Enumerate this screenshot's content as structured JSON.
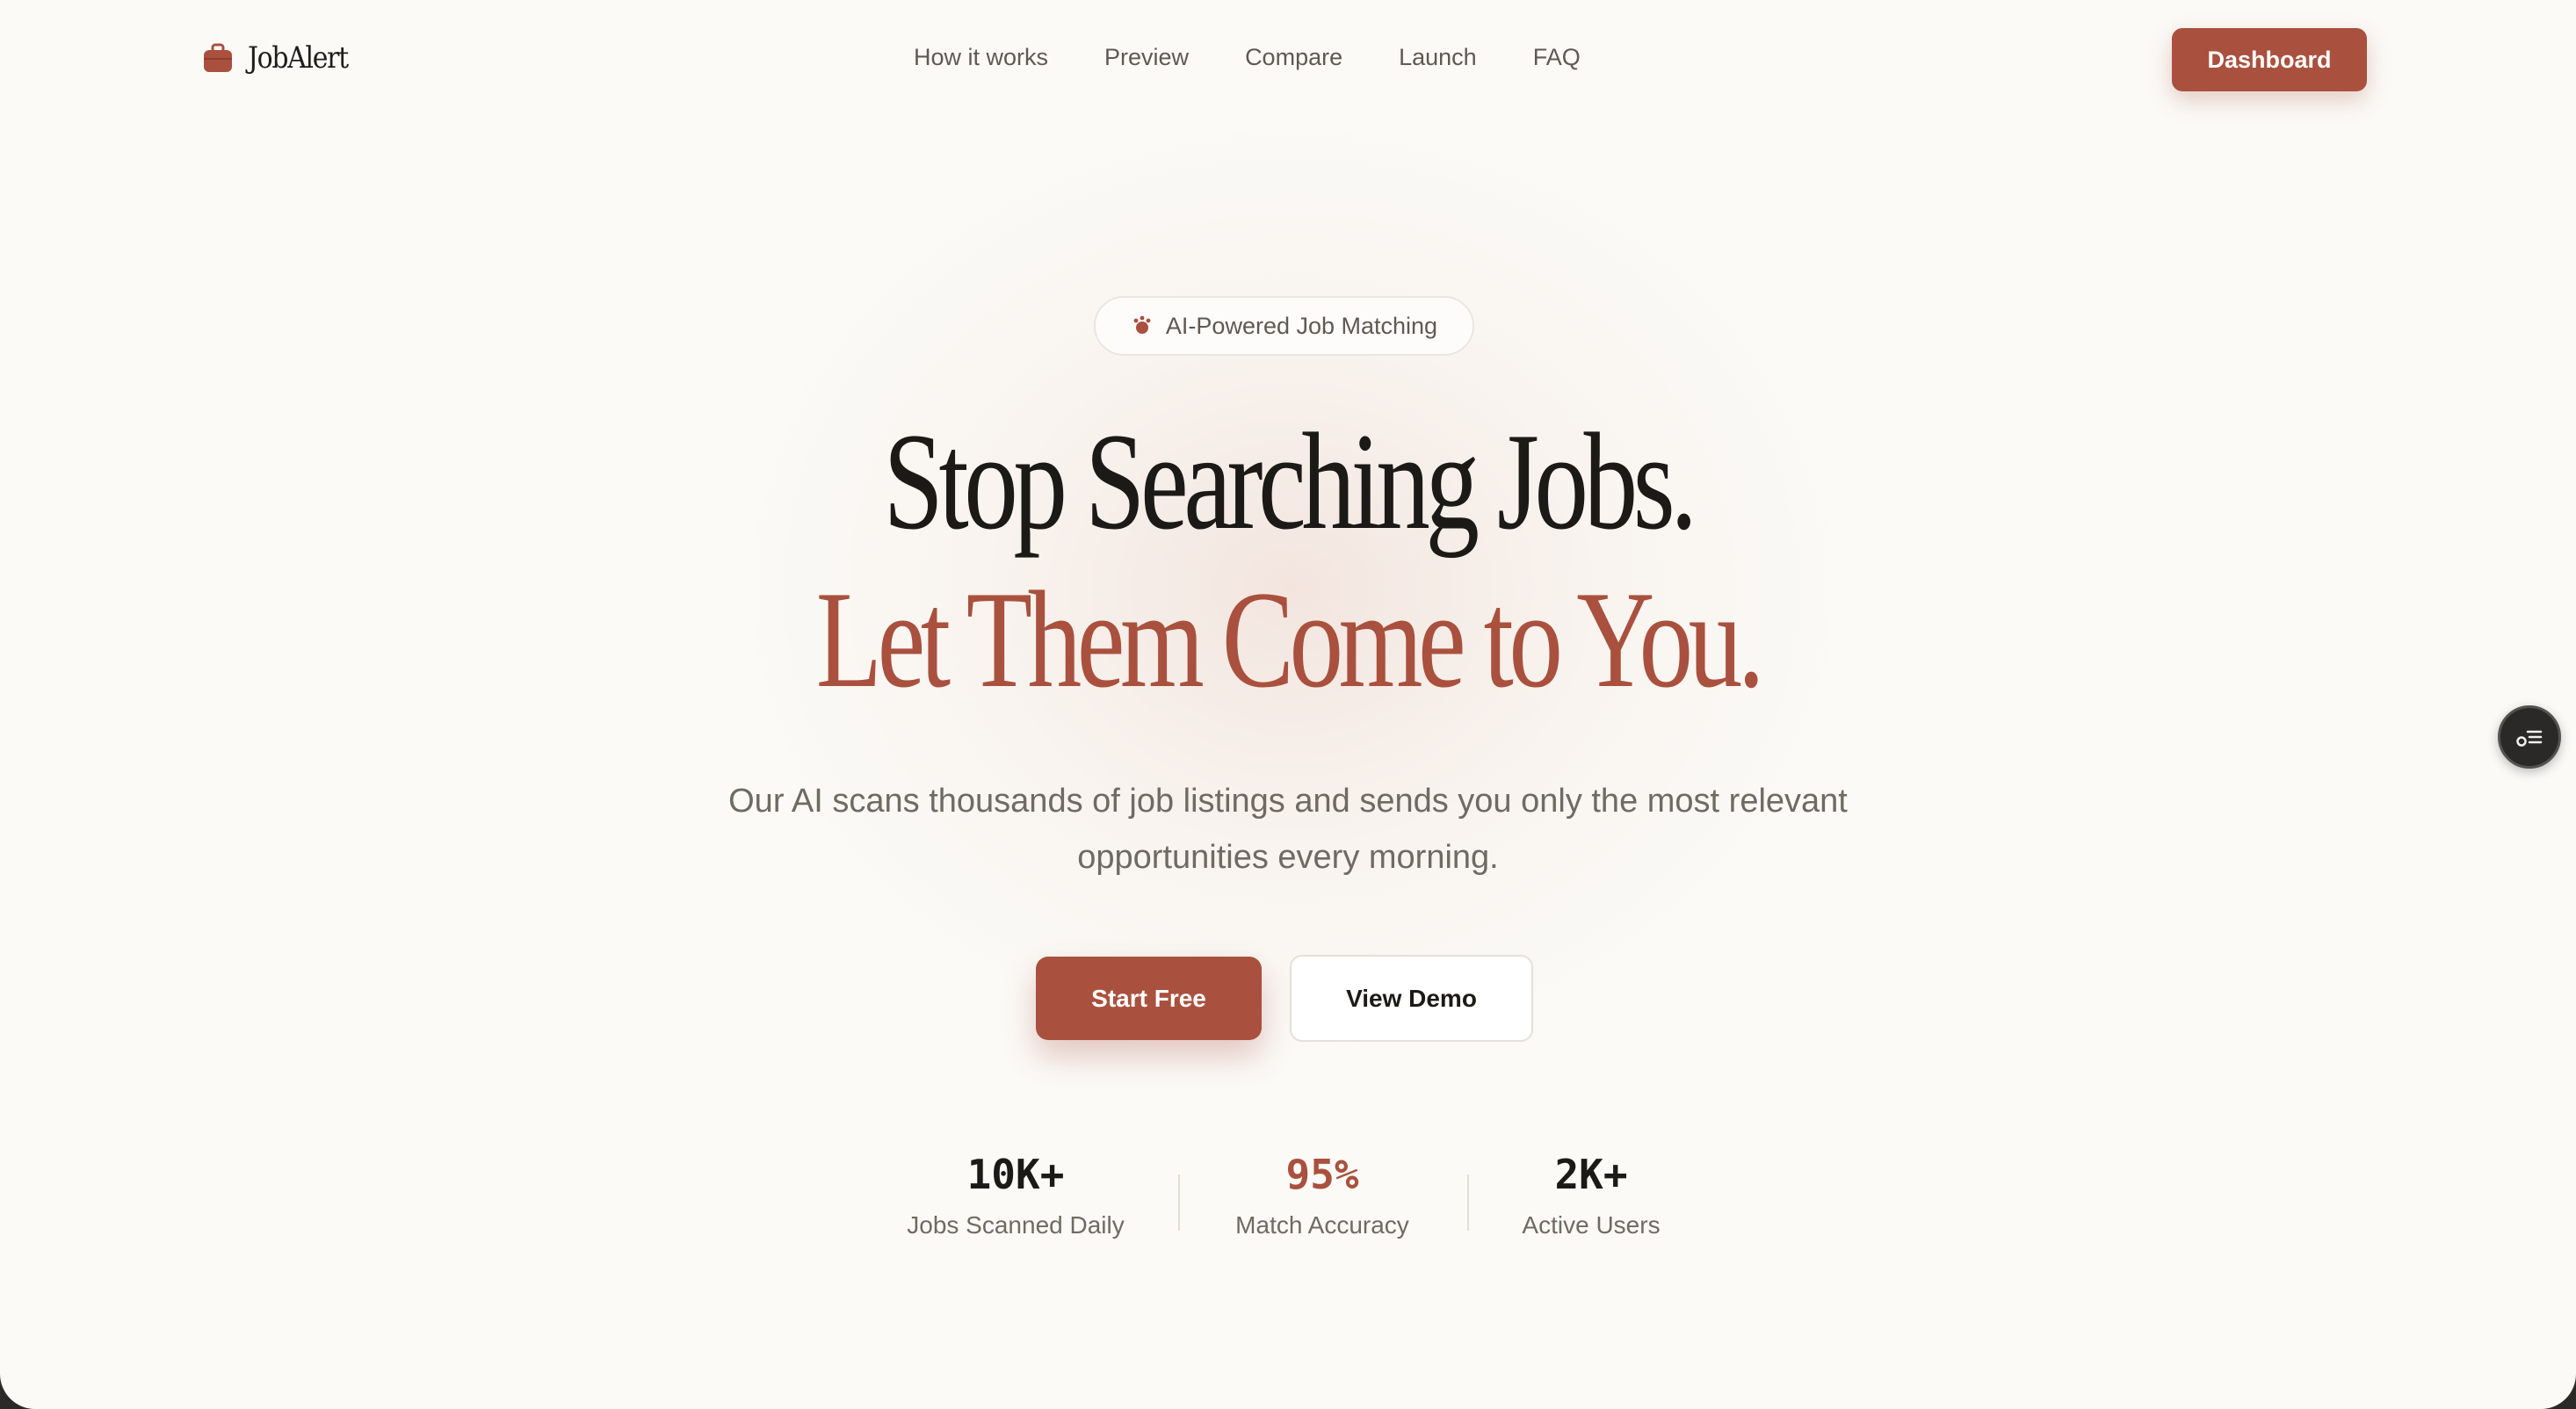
{
  "colors": {
    "accent": "#a9513e",
    "text_dark": "#1c1a17",
    "text_muted": "#6f6a63",
    "background": "#fbfaf7"
  },
  "nav": {
    "brand": "JobAlert",
    "brand_icon": "briefcase-icon",
    "links": [
      "How it works",
      "Preview",
      "Compare",
      "Launch",
      "FAQ"
    ],
    "cta": "Dashboard"
  },
  "hero": {
    "badge_icon": "sparkle-icon",
    "badge": "AI-Powered Job Matching",
    "headline_line1": "Stop Searching Jobs.",
    "headline_line2": "Let Them Come to You.",
    "subtitle": "Our AI scans thousands of job listings and sends you only the most relevant opportunities every morning.",
    "primary_cta": "Start Free",
    "secondary_cta": "View Demo"
  },
  "stats": [
    {
      "value": "10K+",
      "label": "Jobs Scanned Daily",
      "color": "#1c1a17"
    },
    {
      "value": "95%",
      "label": "Match Accuracy",
      "color": "#a9513e"
    },
    {
      "value": "2K+",
      "label": "Active Users",
      "color": "#1c1a17"
    }
  ],
  "floating": {
    "icon": "toc-icon"
  }
}
